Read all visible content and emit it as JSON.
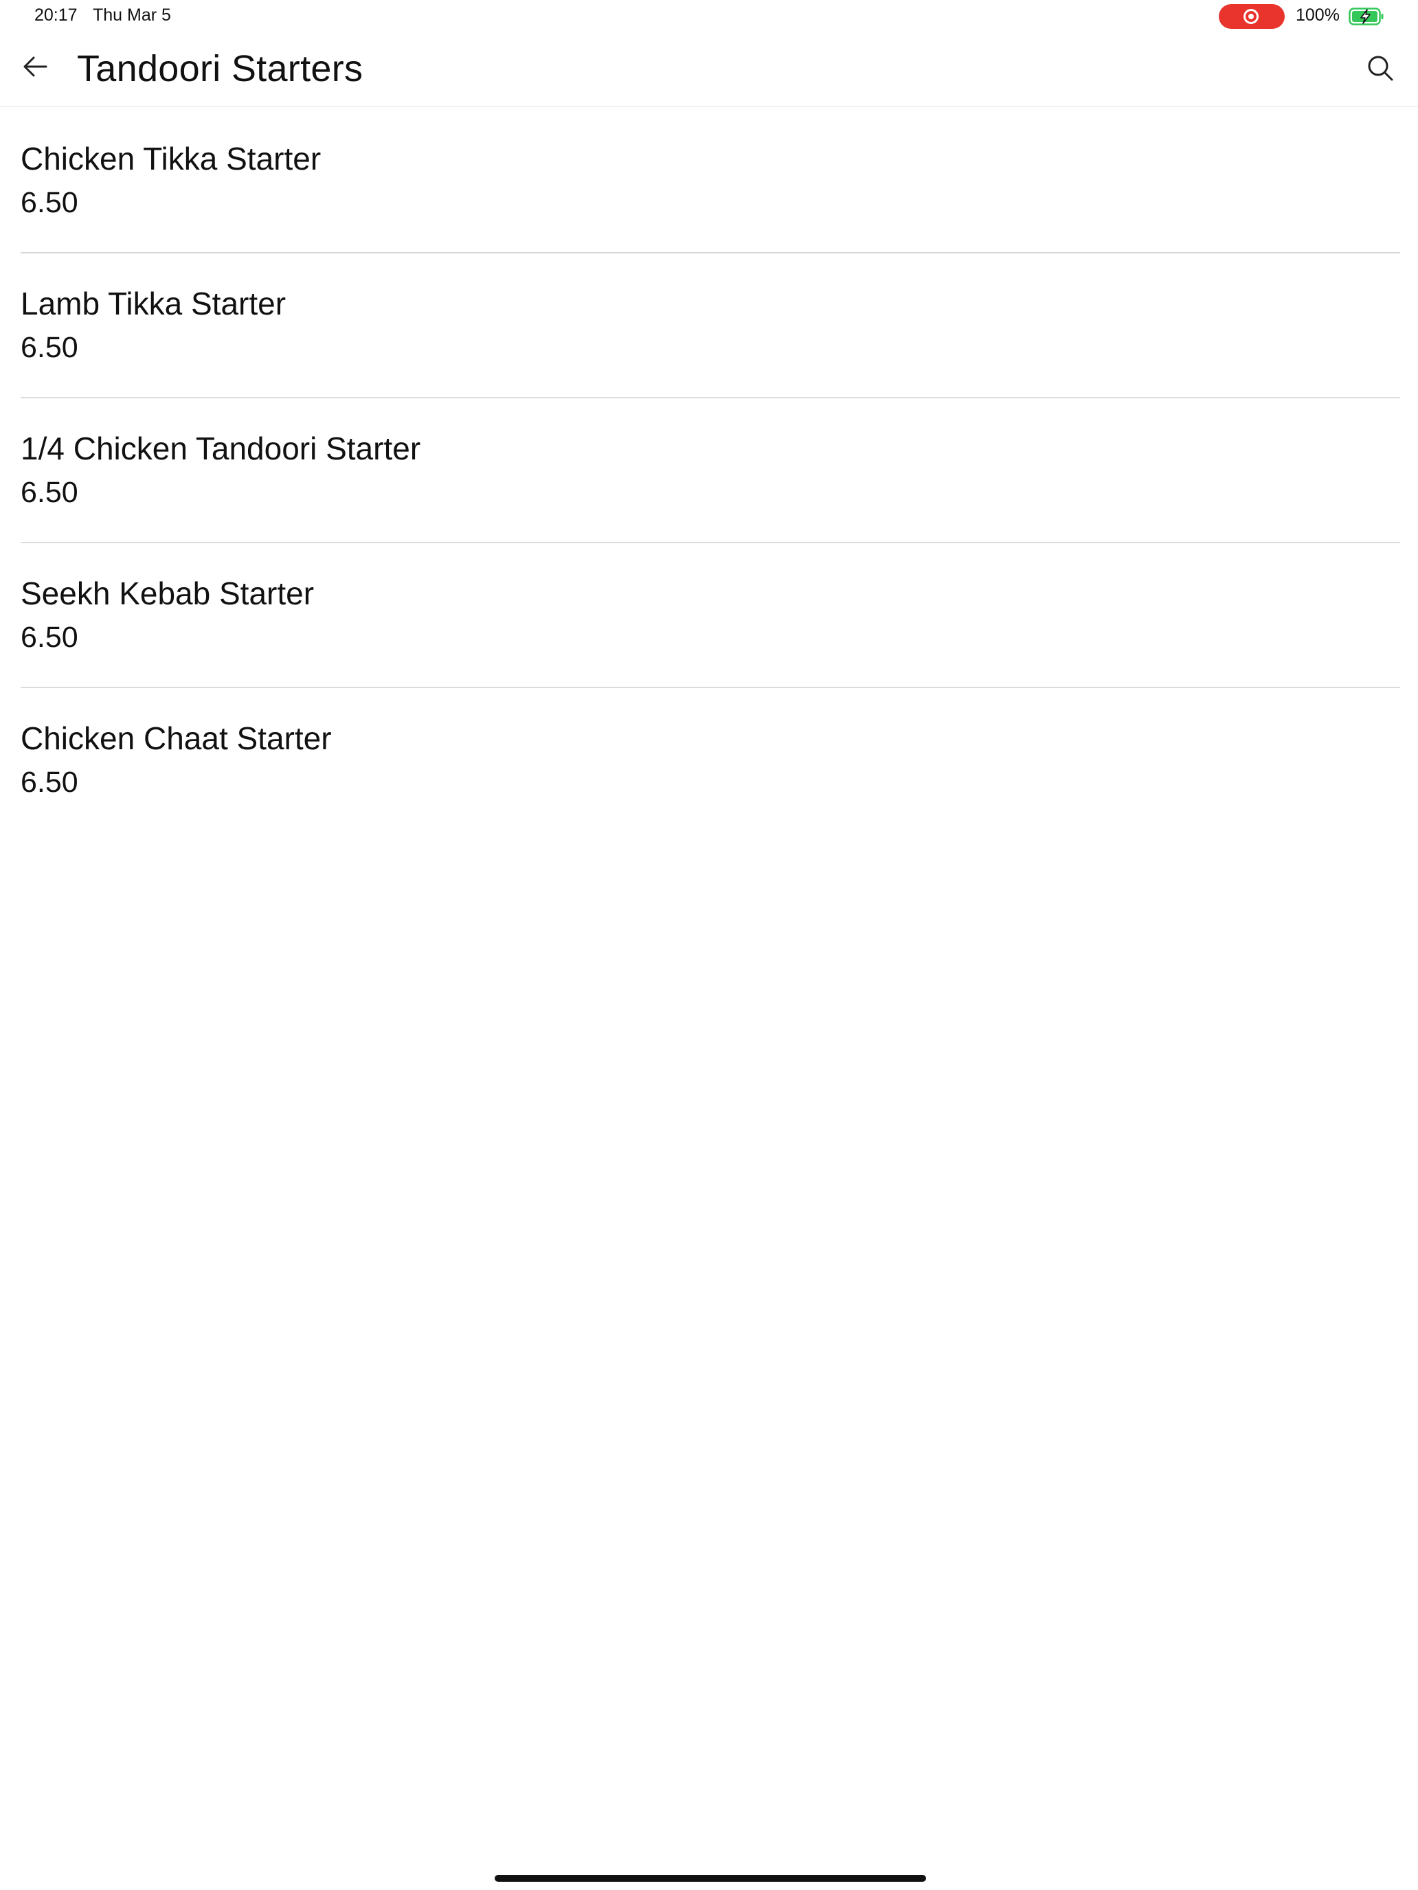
{
  "status_bar": {
    "time": "20:17",
    "date": "Thu Mar 5",
    "battery_percent": "100%",
    "recording_color": "#e8342c",
    "battery_color": "#34c759"
  },
  "header": {
    "title": "Tandoori Starters",
    "back_icon": "arrow-left-icon",
    "search_icon": "search-icon"
  },
  "menu": {
    "items": [
      {
        "name": "Chicken Tikka Starter",
        "price": "6.50"
      },
      {
        "name": "Lamb Tikka Starter",
        "price": "6.50"
      },
      {
        "name": "1/4 Chicken Tandoori Starter",
        "price": "6.50"
      },
      {
        "name": "Seekh Kebab Starter",
        "price": "6.50"
      },
      {
        "name": "Chicken Chaat Starter",
        "price": "6.50"
      }
    ]
  }
}
